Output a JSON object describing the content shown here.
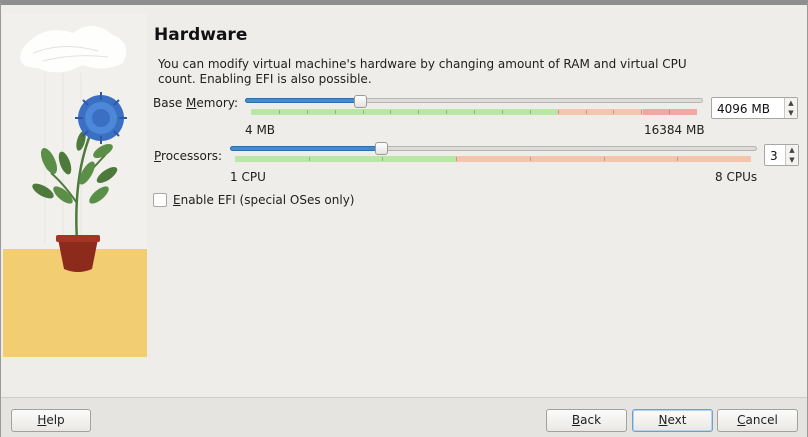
{
  "page": {
    "title": "Hardware",
    "description_line1": "You can modify virtual machine's hardware by changing amount of RAM and virtual CPU",
    "description_line2": "count. Enabling EFI is also possible."
  },
  "memory": {
    "label_pre": "Base ",
    "label_mnemonic": "M",
    "label_post": "emory:",
    "value": "4096 MB",
    "min_label": "4 MB",
    "max_label": "16384 MB",
    "slider_fraction": 0.25
  },
  "processors": {
    "label_mnemonic": "P",
    "label_post": "rocessors:",
    "value": "3",
    "min_label": "1 CPU",
    "max_label": "8 CPUs",
    "slider_fraction": 0.2857
  },
  "efi": {
    "label_mnemonic": "E",
    "label_post": "nable EFI (special OSes only)",
    "checked": false
  },
  "buttons": {
    "help_mnemonic": "H",
    "help_post": "elp",
    "back_mnemonic": "B",
    "back_post": "ack",
    "next_mnemonic": "N",
    "next_post": "ext",
    "cancel_mnemonic": "C",
    "cancel_post": "ancel"
  },
  "colors": {
    "accent": "#3d8ed0",
    "safe": "#b9e8a6",
    "warn": "#f4c4ad",
    "danger": "#efa8a4"
  }
}
